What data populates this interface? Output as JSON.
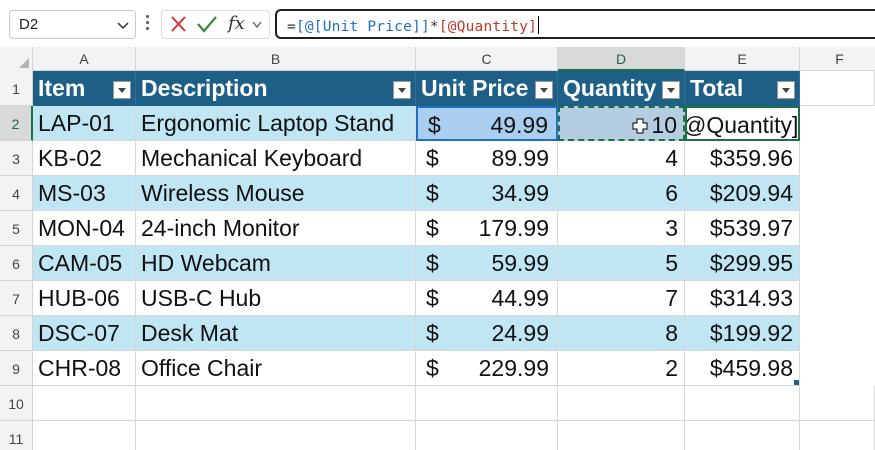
{
  "name_box": {
    "value": "D2"
  },
  "formula_bar": {
    "eq": "=",
    "ref1": "[@[Unit Price]]",
    "op": "*",
    "ref2": "[@Quantity]",
    "fx_label": "fx"
  },
  "columns": [
    "A",
    "B",
    "C",
    "D",
    "E",
    "F"
  ],
  "rows": [
    "1",
    "2",
    "3",
    "4",
    "5",
    "6",
    "7",
    "8",
    "9",
    "10",
    "11"
  ],
  "table": {
    "headers": [
      "Item",
      "Description",
      "Unit Price",
      "Quantity",
      "Total"
    ],
    "currency_symbol": "$",
    "rows": [
      {
        "item": "LAP-01",
        "desc": "Ergonomic Laptop Stand",
        "price": "49.99",
        "qty": "10",
        "total": "@Quantity]"
      },
      {
        "item": "KB-02",
        "desc": "Mechanical Keyboard",
        "price": "89.99",
        "qty": "4",
        "total": "$359.96"
      },
      {
        "item": "MS-03",
        "desc": "Wireless Mouse",
        "price": "34.99",
        "qty": "6",
        "total": "$209.94"
      },
      {
        "item": "MON-04",
        "desc": "24-inch Monitor",
        "price": "179.99",
        "qty": "3",
        "total": "$539.97"
      },
      {
        "item": "CAM-05",
        "desc": "HD Webcam",
        "price": "59.99",
        "qty": "5",
        "total": "$299.95"
      },
      {
        "item": "HUB-06",
        "desc": "USB-C Hub",
        "price": "44.99",
        "qty": "7",
        "total": "$314.93"
      },
      {
        "item": "DSC-07",
        "desc": "Desk Mat",
        "price": "24.99",
        "qty": "8",
        "total": "$199.92"
      },
      {
        "item": "CHR-08",
        "desc": "Office Chair",
        "price": "229.99",
        "qty": "2",
        "total": "$459.98"
      }
    ]
  },
  "colors": {
    "table_header": "#1d5f87",
    "band": "#c0e5f3",
    "reference_blue": "#1f6fc5",
    "reference_red": "#c0392b",
    "selection_green": "#1e7145"
  }
}
